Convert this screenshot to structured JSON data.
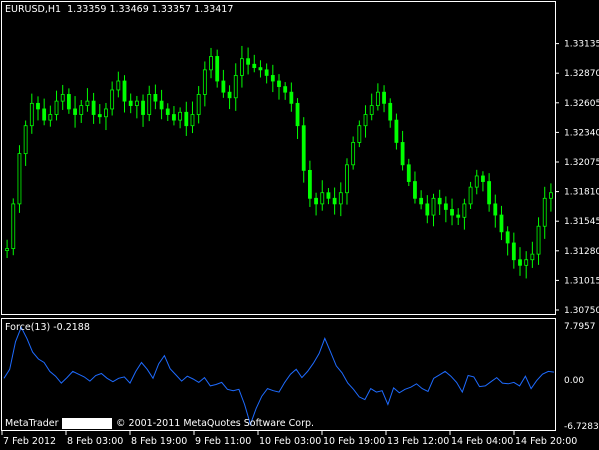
{
  "header": {
    "symbol": "EURUSD,H1",
    "open": "1.33359",
    "high": "1.33469",
    "low": "1.33357",
    "close": "1.33417"
  },
  "indicator": {
    "title": "Force(13) -0.2188",
    "scale_top": "7.7957",
    "scale_mid": "0.00",
    "scale_bottom": "-6.7283"
  },
  "footer": {
    "brand": "MetaTrader",
    "copyright": "© 2001-2011 MetaQuotes Software Corp."
  },
  "colors": {
    "background": "#000000",
    "candle": "#00ff00",
    "force_line": "#1e6bff",
    "grid": "#ffffff"
  },
  "price_axis": [
    "1.33135",
    "1.32870",
    "1.32605",
    "1.32340",
    "1.32075",
    "1.31810",
    "1.31545",
    "1.31280",
    "1.31015",
    "1.30750"
  ],
  "time_axis": [
    "7 Feb 2012",
    "8 Feb 03:00",
    "8 Feb 19:00",
    "9 Feb 11:00",
    "10 Feb 03:00",
    "10 Feb 19:00",
    "13 Feb 12:00",
    "14 Feb 04:00",
    "14 Feb 20:00"
  ],
  "chart_data": [
    {
      "type": "line",
      "title": "EURUSD,H1",
      "ylim": [
        1.3075,
        1.334
      ],
      "series": [
        {
          "values": [
            1.313,
            1.317,
            1.3215,
            1.324,
            1.326,
            1.3255,
            1.3245,
            1.325,
            1.3262,
            1.3268,
            1.3255,
            1.325,
            1.3258,
            1.3262,
            1.325,
            1.3248,
            1.3255,
            1.3272,
            1.328,
            1.3262,
            1.3258,
            1.3262,
            1.325,
            1.3268,
            1.3262,
            1.3255,
            1.325,
            1.3245,
            1.3252,
            1.324,
            1.325,
            1.3268,
            1.329,
            1.3302,
            1.328,
            1.327,
            1.3265,
            1.3285,
            1.33,
            1.3295,
            1.3292,
            1.329,
            1.3285,
            1.328,
            1.3275,
            1.327,
            1.326,
            1.324,
            1.32,
            1.3175,
            1.317,
            1.318,
            1.3175,
            1.317,
            1.318,
            1.3205,
            1.3225,
            1.324,
            1.325,
            1.3258,
            1.327,
            1.326,
            1.3245,
            1.3225,
            1.3205,
            1.319,
            1.3175,
            1.317,
            1.316,
            1.3175,
            1.317,
            1.3165,
            1.316,
            1.3158,
            1.317,
            1.3185,
            1.3195,
            1.319,
            1.317,
            1.316,
            1.3145,
            1.3135,
            1.312,
            1.3115,
            1.312,
            1.3125,
            1.315,
            1.3175,
            1.318
          ]
        }
      ]
    },
    {
      "type": "line",
      "title": "Force(13) -0.2188",
      "ylim": [
        -6.7283,
        7.7957
      ],
      "series": [
        {
          "values": [
            0.2,
            1.5,
            5.5,
            7.6,
            6.0,
            4.0,
            3.0,
            2.5,
            1.2,
            0.5,
            -0.5,
            0.3,
            1.2,
            0.8,
            0.4,
            -0.2,
            0.6,
            0.9,
            0.2,
            -0.3,
            0.2,
            0.4,
            -0.5,
            1.2,
            2.5,
            1.5,
            0.2,
            2.3,
            3.5,
            1.6,
            0.7,
            -0.2,
            0.5,
            0.1,
            -0.4,
            0.3,
            -0.9,
            -0.7,
            -0.4,
            -1.4,
            -1.6,
            -1.4,
            -3.6,
            -6.5,
            -4.2,
            -2.4,
            -1.3,
            -1.6,
            -1.8,
            -0.4,
            0.8,
            1.5,
            0.3,
            1.2,
            2.4,
            3.8,
            6.0,
            4.0,
            2.0,
            1.0,
            -0.5,
            -1.4,
            -2.5,
            -2.9,
            -1.3,
            -1.8,
            -1.6,
            -3.6,
            -1.2,
            -1.9,
            -1.4,
            -1.1,
            -0.6,
            -1.3,
            -1.7,
            0.2,
            0.7,
            1.2,
            0.5,
            -0.4,
            -1.8,
            0.6,
            0.4,
            -1.0,
            -0.9,
            -0.3,
            0.3,
            -0.5,
            -0.6,
            -0.4,
            -0.9,
            0.5,
            -1.3,
            -0.1,
            0.8,
            1.2,
            1.1
          ]
        }
      ]
    }
  ]
}
